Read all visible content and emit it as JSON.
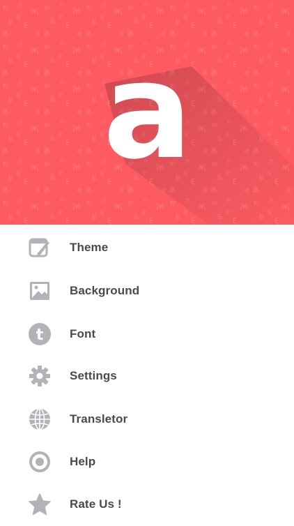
{
  "colors": {
    "brand": "#fd5a62",
    "icon": "#b2b2b8",
    "label": "#4a4a4d",
    "logo": "#ffffff"
  },
  "header": {
    "logo_letter": "a",
    "logo_icon": "letter-a-logo"
  },
  "menu": {
    "items": [
      {
        "label": "Theme",
        "icon": "theme-icon"
      },
      {
        "label": "Background",
        "icon": "image-icon"
      },
      {
        "label": "Font",
        "icon": "font-icon"
      },
      {
        "label": "Settings",
        "icon": "gear-icon"
      },
      {
        "label": "Transletor",
        "icon": "globe-icon"
      },
      {
        "label": "Help",
        "icon": "help-icon"
      },
      {
        "label": "Rate Us !",
        "icon": "star-icon"
      }
    ]
  }
}
